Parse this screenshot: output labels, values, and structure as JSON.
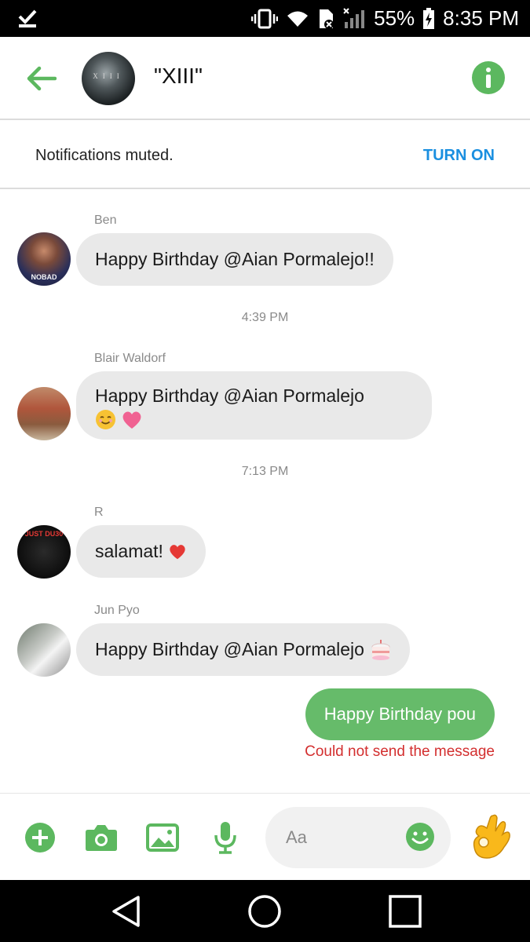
{
  "status_bar": {
    "battery": "55%",
    "time": "8:35 PM"
  },
  "header": {
    "title": "\"XIII\"",
    "avatar_text": "XIII",
    "accent": "#5cb85f"
  },
  "notification": {
    "text": "Notifications muted.",
    "action": "TURN ON",
    "action_color": "#1a8fe0"
  },
  "messages": [
    {
      "sender": "Ben",
      "text": "Happy Birthday @Aian Pormalejo!!",
      "avatar_label": "NOBAD"
    },
    {
      "time": "4:39 PM"
    },
    {
      "sender": "Blair Waldorf",
      "text": "Happy Birthday @Aian Pormalejo",
      "emoji": [
        "smiling-face-icon",
        "pink-heart-icon"
      ]
    },
    {
      "time": "7:13 PM"
    },
    {
      "sender": "R",
      "text": "salamat!",
      "emoji": [
        "red-heart-icon"
      ],
      "avatar_label": "JUST DU30"
    },
    {
      "sender": "Jun Pyo",
      "text": "Happy Birthday @Aian Pormalejo",
      "emoji": [
        "birthday-cake-icon"
      ]
    }
  ],
  "outgoing": {
    "text": "Happy Birthday pou",
    "error": "Could not send the message",
    "bubble_color": "#66bb6a",
    "error_color": "#d32f2f"
  },
  "composer": {
    "placeholder": "Aa",
    "buttons": [
      "plus-icon",
      "camera-icon",
      "gallery-icon",
      "microphone-icon",
      "emoji-icon",
      "ok-hand-icon"
    ]
  },
  "navbar": {
    "buttons": [
      "back-icon",
      "home-icon",
      "recents-icon"
    ]
  }
}
